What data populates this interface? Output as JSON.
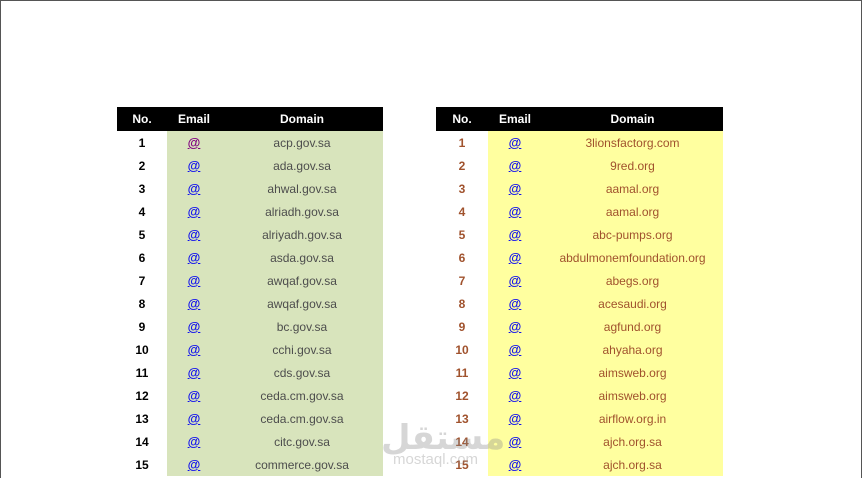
{
  "tables": [
    {
      "headers": {
        "no": "No.",
        "email": "Email",
        "domain": "Domain"
      },
      "rows": [
        {
          "no": "1",
          "email": "@",
          "domain": "acp.gov.sa"
        },
        {
          "no": "2",
          "email": "@",
          "domain": "ada.gov.sa"
        },
        {
          "no": "3",
          "email": "@",
          "domain": "ahwal.gov.sa"
        },
        {
          "no": "4",
          "email": "@",
          "domain": "alriadh.gov.sa"
        },
        {
          "no": "5",
          "email": "@",
          "domain": "alriyadh.gov.sa"
        },
        {
          "no": "6",
          "email": "@",
          "domain": "asda.gov.sa"
        },
        {
          "no": "7",
          "email": "@",
          "domain": "awqaf.gov.sa"
        },
        {
          "no": "8",
          "email": "@",
          "domain": "awqaf.gov.sa"
        },
        {
          "no": "9",
          "email": "@",
          "domain": "bc.gov.sa"
        },
        {
          "no": "10",
          "email": "@",
          "domain": "cchi.gov.sa"
        },
        {
          "no": "11",
          "email": "@",
          "domain": "cds.gov.sa"
        },
        {
          "no": "12",
          "email": "@",
          "domain": "ceda.cm.gov.sa"
        },
        {
          "no": "13",
          "email": "@",
          "domain": "ceda.cm.gov.sa"
        },
        {
          "no": "14",
          "email": "@",
          "domain": "citc.gov.sa"
        },
        {
          "no": "15",
          "email": "@",
          "domain": "commerce.gov.sa"
        }
      ]
    },
    {
      "headers": {
        "no": "No.",
        "email": "Email",
        "domain": "Domain"
      },
      "rows": [
        {
          "no": "1",
          "email": "@",
          "domain": "3lionsfactorg.com"
        },
        {
          "no": "2",
          "email": "@",
          "domain": "9red.org"
        },
        {
          "no": "3",
          "email": "@",
          "domain": "aamal.org"
        },
        {
          "no": "4",
          "email": "@",
          "domain": "aamal.org"
        },
        {
          "no": "5",
          "email": "@",
          "domain": "abc-pumps.org"
        },
        {
          "no": "6",
          "email": "@",
          "domain": "abdulmonemfoundation.org"
        },
        {
          "no": "7",
          "email": "@",
          "domain": "abegs.org"
        },
        {
          "no": "8",
          "email": "@",
          "domain": "acesaudi.org"
        },
        {
          "no": "9",
          "email": "@",
          "domain": "agfund.org"
        },
        {
          "no": "10",
          "email": "@",
          "domain": "ahyaha.org"
        },
        {
          "no": "11",
          "email": "@",
          "domain": "aimsweb.org"
        },
        {
          "no": "12",
          "email": "@",
          "domain": "aimsweb.org"
        },
        {
          "no": "13",
          "email": "@",
          "domain": "airflow.org.in"
        },
        {
          "no": "14",
          "email": "@",
          "domain": "ajch.org.sa"
        },
        {
          "no": "15",
          "email": "@",
          "domain": "ajch.org.sa"
        }
      ]
    }
  ],
  "watermark": {
    "arabic": "مستقل",
    "latin": "mostaql.com"
  },
  "colors": {
    "left_fill": "#d8e4bc",
    "right_fill": "#ffff9f",
    "header_bg": "#000000",
    "link_blue": "#1010ee",
    "link_visited": "#800080",
    "right_text": "#a0522d"
  }
}
